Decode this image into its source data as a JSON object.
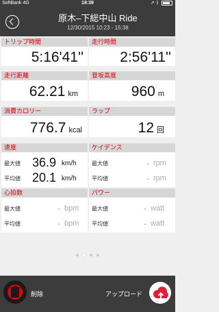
{
  "status_bar": {
    "carrier": "SoftBank",
    "network": "4G",
    "time": "18:39",
    "battery_level": 0.8
  },
  "header": {
    "title": "原木–下総中山 Ride",
    "subtitle": "12/30/2015 10:23 - 15:38"
  },
  "stats": {
    "trip_time": {
      "label": "トリップ時間",
      "value": "5:16'41''"
    },
    "moving_time": {
      "label": "走行時間",
      "value": "2:56'11''"
    },
    "distance": {
      "label": "走行距離",
      "value": "62.21",
      "unit": "km"
    },
    "elevation": {
      "label": "登坂高度",
      "value": "960",
      "unit": "m"
    },
    "calories": {
      "label": "消費カロリー",
      "value": "776.7",
      "unit": "kcal"
    },
    "laps": {
      "label": "ラップ",
      "value": "12",
      "unit": "回"
    }
  },
  "speed": {
    "label": "速度",
    "max_label": "最大値",
    "max_value": "36.9",
    "avg_label": "平均値",
    "avg_value": "20.1",
    "unit": "km/h"
  },
  "cadence": {
    "label": "ケイデンス",
    "max_label": "最大値",
    "max_value": "-",
    "avg_label": "平均値",
    "avg_value": "-",
    "unit": "rpm"
  },
  "heart_rate": {
    "label": "心拍数",
    "max_label": "最大値",
    "max_value": "-",
    "avg_label": "平均値",
    "avg_value": "-",
    "unit": "bpm"
  },
  "power": {
    "label": "パワー",
    "max_label": "最大値",
    "max_value": "-",
    "avg_label": "平均値",
    "avg_value": "-",
    "unit": "watt"
  },
  "pager": {
    "total": 4,
    "active": 2
  },
  "actions": {
    "delete_label": "削除",
    "upload_label": "アップロード"
  },
  "colors": {
    "accent": "#d00010",
    "bar": "#3c3c3c",
    "section_header": "#d6d6d6"
  }
}
